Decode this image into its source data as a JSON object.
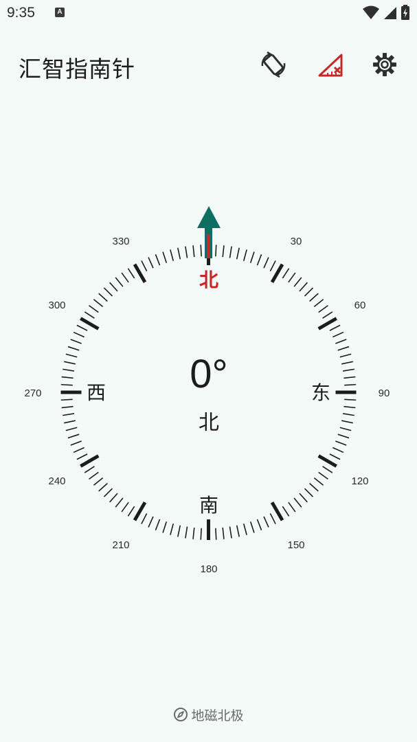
{
  "status_bar": {
    "time": "9:35",
    "notification_glyph": "A",
    "icons": [
      "wifi-icon",
      "signal-icon",
      "battery-icon"
    ]
  },
  "app_bar": {
    "title": "汇智指南针",
    "actions": [
      "screen-rotate-icon",
      "level-off-icon",
      "settings-icon"
    ],
    "accent_color": "#c62828"
  },
  "compass": {
    "heading_value": "0°",
    "heading_direction": "北",
    "cardinals": {
      "north": "北",
      "east": "东",
      "south": "南",
      "west": "西"
    },
    "degree_labels": {
      "d0": "",
      "d30": "30",
      "d60": "60",
      "d90": "90",
      "d120": "120",
      "d150": "150",
      "d180": "180",
      "d210": "210",
      "d240": "240",
      "d270": "270",
      "d300": "300",
      "d330": "330"
    },
    "needle_color": "#0f6e62",
    "north_color": "#c62828"
  },
  "footer": {
    "label": "地磁北极",
    "icon": "compass-icon"
  }
}
